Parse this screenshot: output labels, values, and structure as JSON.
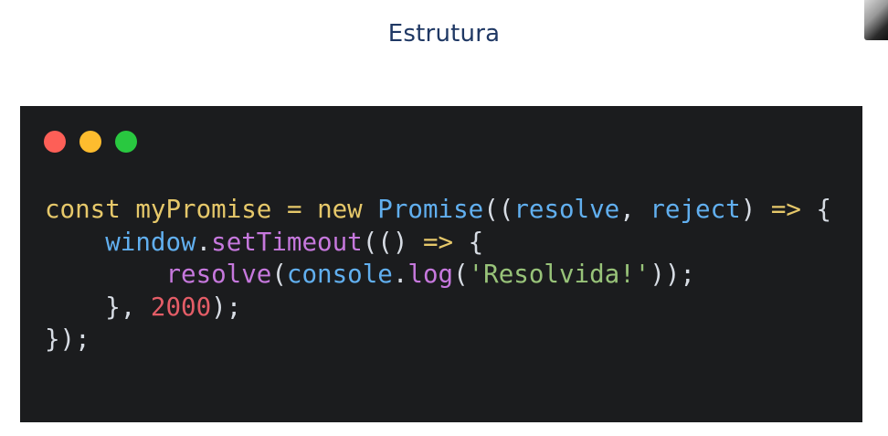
{
  "slide": {
    "title": "Estrutura"
  },
  "code_window": {
    "traffic_lights": [
      "close",
      "minimize",
      "maximize"
    ],
    "colors": {
      "background": "#1b1c1e",
      "close": "#fd5f57",
      "minimize": "#febc2e",
      "maximize": "#29c840"
    },
    "lines": [
      "const myPromise = new Promise((resolve, reject) => {",
      "    window.setTimeout(() => {",
      "        resolve(console.log('Resolvida!'));",
      "    }, 2000);",
      "});"
    ],
    "tokens": {
      "l1": {
        "kw_const": "const",
        "var_name": "myPromise",
        "op_eq": "=",
        "kw_new": "new",
        "cls_promise": "Promise",
        "open": "((",
        "p_resolve": "resolve",
        "comma": ",",
        "p_reject": "reject",
        "close": ")",
        "arrow": "=>",
        "brace": "{"
      },
      "l2": {
        "obj_window": "window",
        "dot": ".",
        "fn_settimeout": "setTimeout",
        "open": "(()",
        "arrow": "=>",
        "brace": "{"
      },
      "l3": {
        "fn_resolve": "resolve",
        "open": "(",
        "obj_console": "console",
        "dot": ".",
        "fn_log": "log",
        "open2": "(",
        "str": "'Resolvida!'",
        "close": "));"
      },
      "l4": {
        "brace": "},",
        "num": "2000",
        "close": ");"
      },
      "l5": {
        "close": "});"
      }
    }
  }
}
